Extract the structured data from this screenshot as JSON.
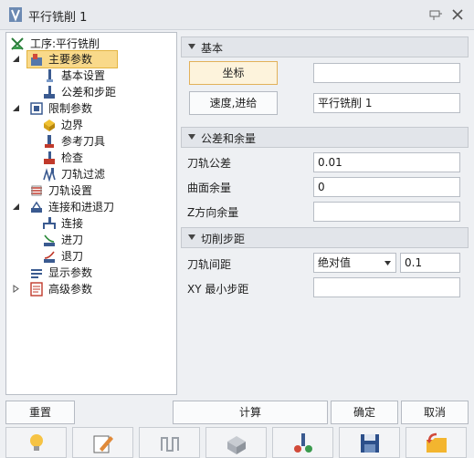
{
  "window": {
    "title": "平行铣削 1"
  },
  "tree": {
    "root": "工序:平行铣削",
    "main_params": "主要参数",
    "basic_settings": "基本设置",
    "tolerance_step": "公差和步距",
    "limit_params": "限制参数",
    "boundary": "边界",
    "ref_tool": "参考刀具",
    "check": "检查",
    "toolpath_filter": "刀轨过滤",
    "toolpath_settings": "刀轨设置",
    "link_lead": "连接和进退刀",
    "connect": "连接",
    "lead_in": "进刀",
    "lead_out": "退刀",
    "display_params": "显示参数",
    "advanced_params": "高级参数"
  },
  "basic": {
    "header": "基本",
    "coord_button": "坐标",
    "coord_value": "",
    "speed_button": "速度,进给",
    "speed_value": "平行铣削 1"
  },
  "tolerance": {
    "header": "公差和余量",
    "toolpath_tol_label": "刀轨公差",
    "toolpath_tol_value": "0.01",
    "surface_stock_label": "曲面余量",
    "surface_stock_value": "0",
    "z_stock_label": "Z方向余量",
    "z_stock_value": ""
  },
  "stepover": {
    "header": "切削步距",
    "spacing_label": "刀轨间距",
    "spacing_mode": "绝对值",
    "spacing_value": "0.1",
    "xy_min_label": "XY 最小步距",
    "xy_min_value": ""
  },
  "buttons": {
    "reset": "重置",
    "compute": "计算",
    "ok": "确定",
    "cancel": "取消"
  },
  "toolbar_icons": [
    "lightbulb-icon",
    "edit-icon",
    "path-icon",
    "simulate-icon",
    "analyze-icon",
    "save-icon",
    "open-icon"
  ]
}
